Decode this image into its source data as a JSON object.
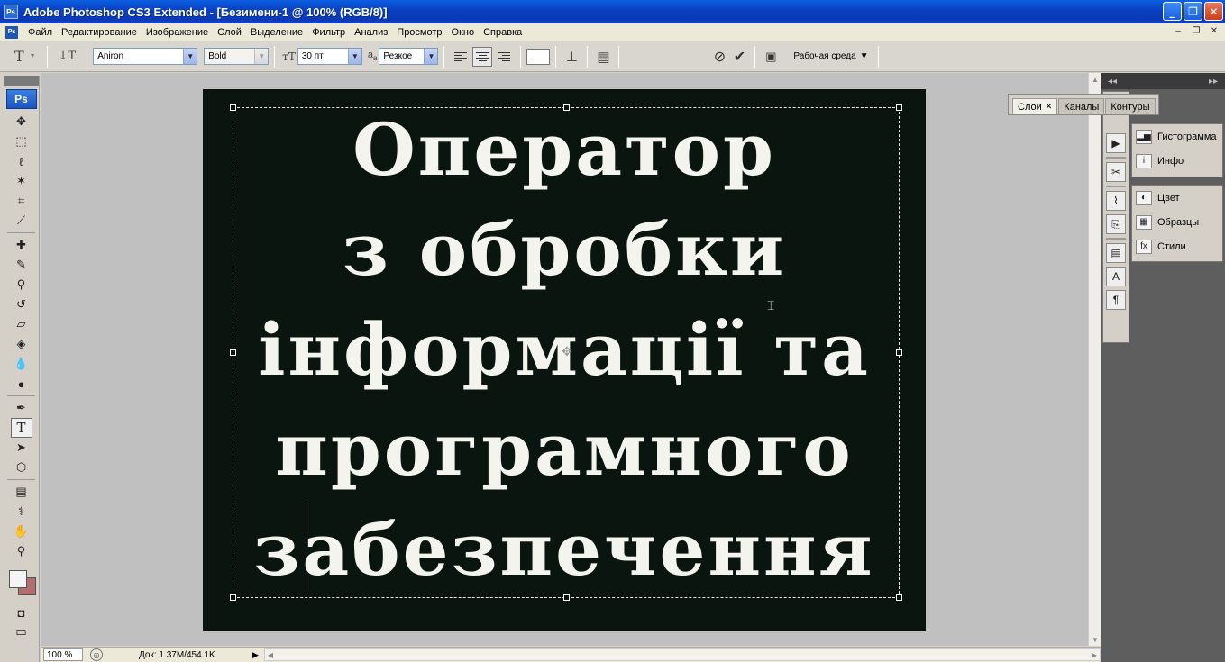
{
  "window": {
    "title": "Adobe Photoshop CS3 Extended - [Безимени-1 @ 100% (RGB/8)]",
    "app_icon": "Ps"
  },
  "menu": [
    "Файл",
    "Редактирование",
    "Изображение",
    "Слой",
    "Выделение",
    "Фильтр",
    "Анализ",
    "Просмотр",
    "Окно",
    "Справка"
  ],
  "options": {
    "font_family": "Aniron",
    "font_style": "Bold",
    "font_size": "30 пт",
    "antialias_label": "a",
    "antialias_sub": "a",
    "antialias": "Резкое",
    "workspace": "Рабочая среда"
  },
  "toolbox": {
    "logo": "Ps"
  },
  "canvas": {
    "lines": [
      "Оператор",
      "з обробки",
      "інформації та",
      "програмного",
      "забезпечення"
    ],
    "background": "#0b150f",
    "text_color": "#f4f4ee"
  },
  "status": {
    "zoom": "100 %",
    "doc": "Док: 1.37M/454.1K"
  },
  "float_tabs": [
    "Слои",
    "Каналы",
    "Контуры"
  ],
  "panels": {
    "group1": [
      {
        "label": "Гистограмма",
        "icon": "histogram-icon"
      },
      {
        "label": "Инфо",
        "icon": "info-icon"
      }
    ],
    "group2": [
      {
        "label": "Цвет",
        "icon": "color-icon"
      },
      {
        "label": "Образцы",
        "icon": "swatches-icon"
      },
      {
        "label": "Стили",
        "icon": "styles-icon"
      }
    ]
  }
}
